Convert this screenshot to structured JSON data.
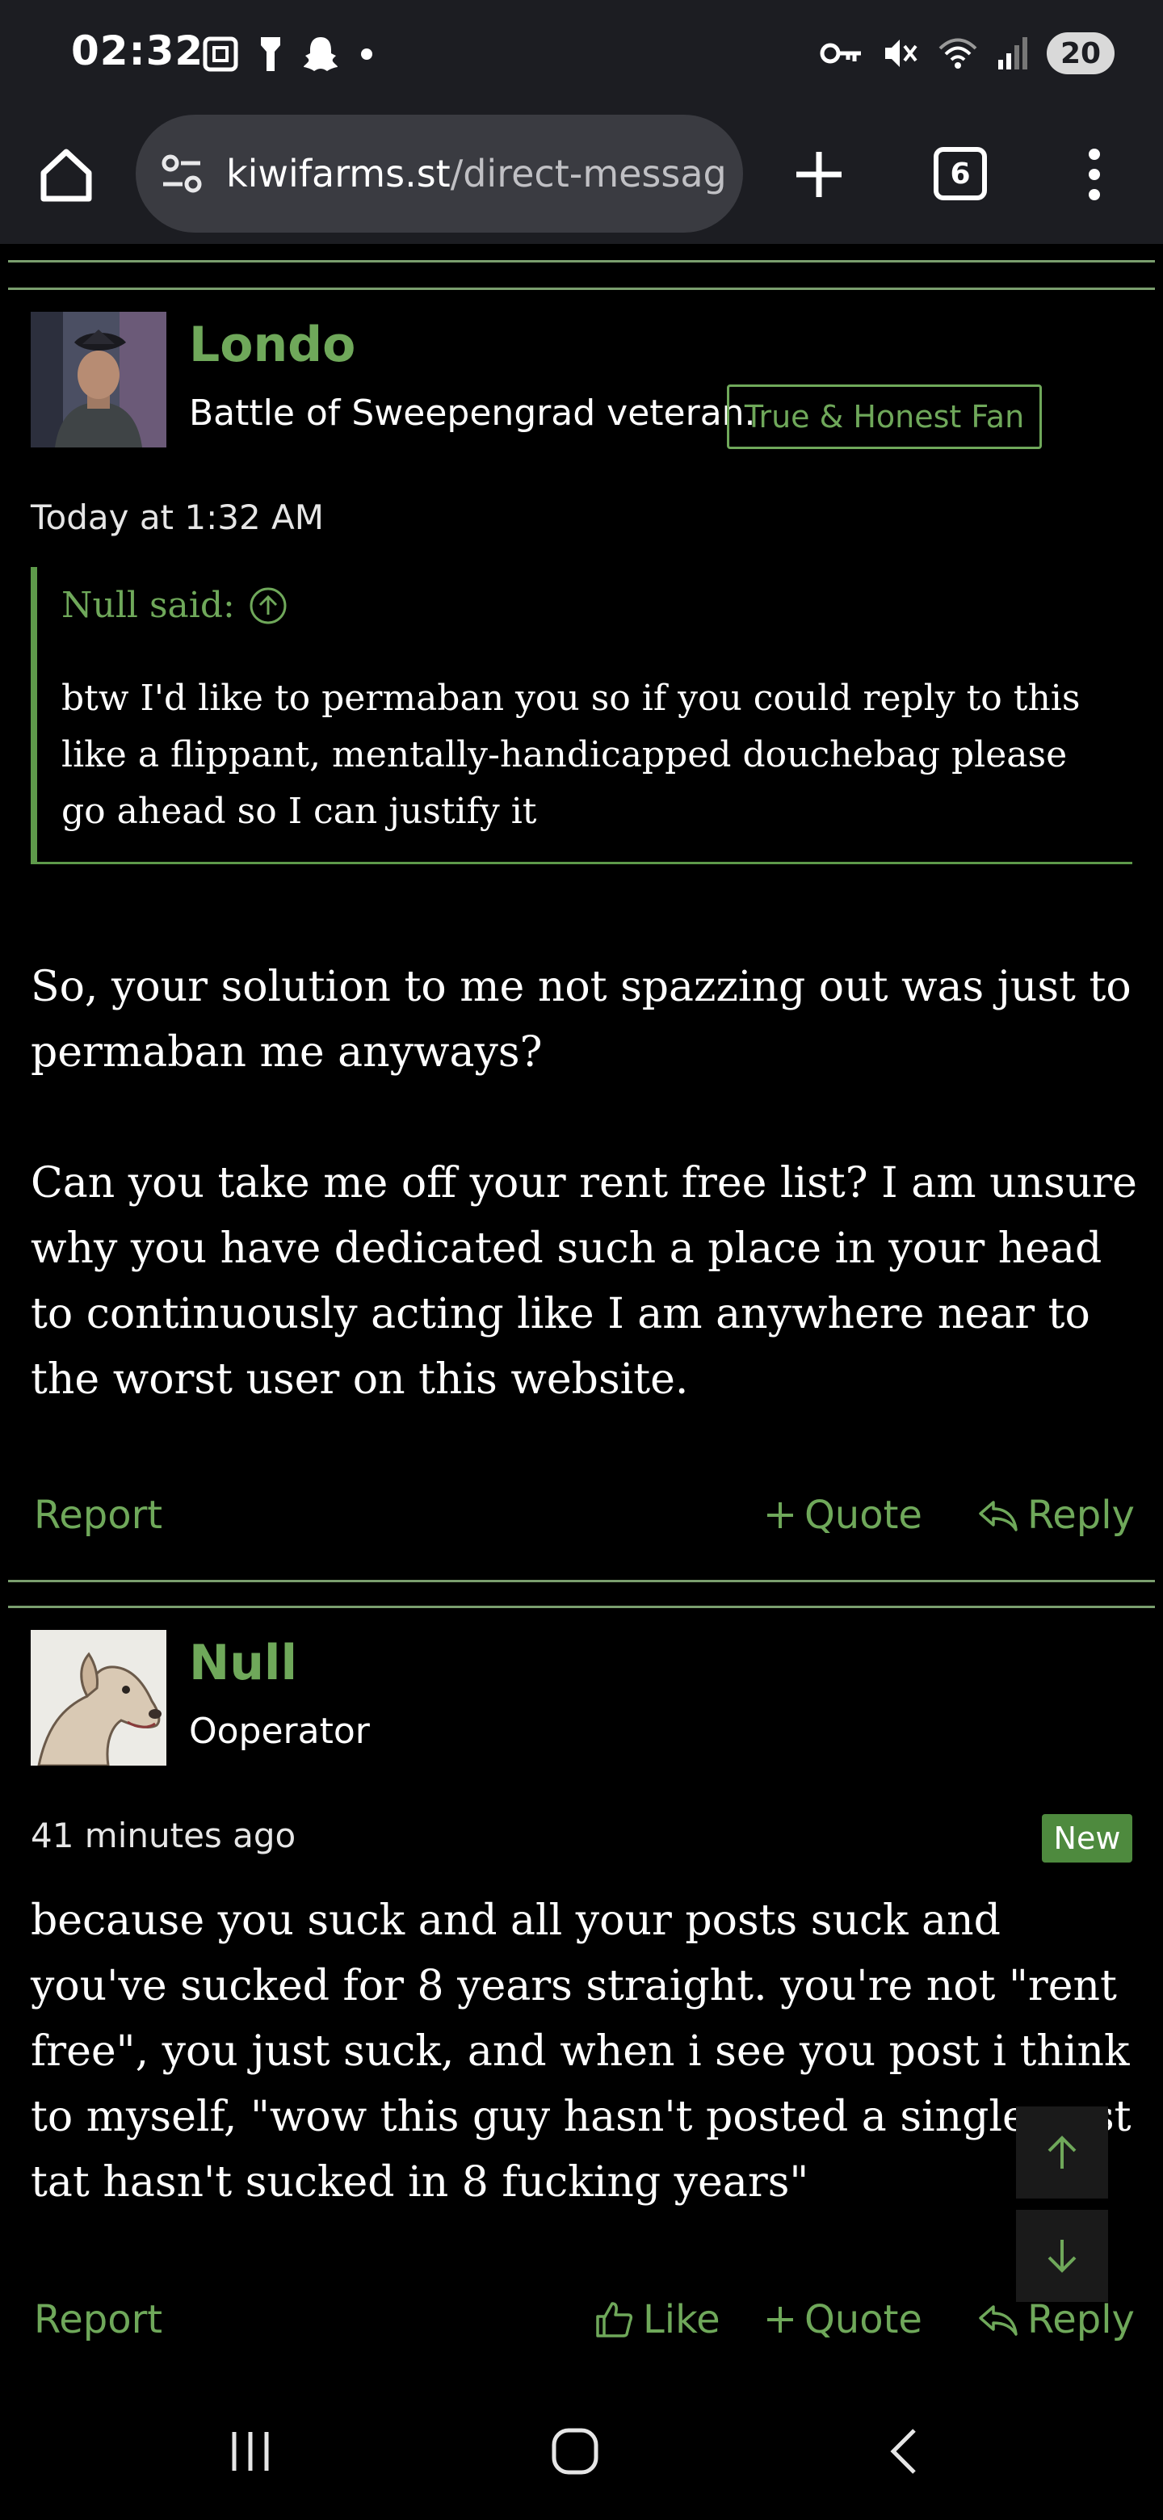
{
  "status_bar": {
    "time": "02:32",
    "battery": "20"
  },
  "browser": {
    "url_host": "kiwifarms.st",
    "url_path": "/direct-messag",
    "tab_count": "6"
  },
  "posts": [
    {
      "username": "Londo",
      "user_title": "Battle of Sweepengrad veteran.",
      "banner": "True & Honest Fan",
      "time": "Today at 1:32 AM",
      "quote": {
        "attribution": "Null said:",
        "text": "btw I'd like to permaban you so if you could reply to this like a flippant, mentally-handicapped douchebag please go ahead so I can justify it"
      },
      "paragraphs": [
        "So, your solution to me not spazzing out was just to permaban me anyways?",
        "Can you take me off your rent free list? I am unsure why you have dedicated such a place in your head to continuously acting like I am anywhere near to the worst user on this website."
      ],
      "actions": {
        "report": "Report",
        "quote": "Quote",
        "reply": "Reply"
      }
    },
    {
      "username": "Null",
      "user_title": "Ooperator",
      "time": "41 minutes ago",
      "badge": "New",
      "paragraphs": [
        "because you suck and all your posts suck and you've sucked for 8 years straight. you're not \"rent free\", you just suck, and when i see you post i think to myself, \"wow this guy hasn't posted a single post tat hasn't sucked in 8 fucking years\""
      ],
      "actions": {
        "report": "Report",
        "like": "Like",
        "quote": "Quote",
        "reply": "Reply"
      }
    }
  ],
  "colors": {
    "accent": "#6fa85a",
    "divider": "#7a9e6e",
    "chrome_bg": "#1c1d22",
    "url_bg": "#3a3b41",
    "badge_bg": "#4e8a3e"
  },
  "icons": {
    "status_left": [
      "screenshot-icon",
      "flashlight-icon",
      "snapchat-icon",
      "notification-dot-icon"
    ],
    "status_right": [
      "vpn-key-icon",
      "mute-icon",
      "wifi-icon",
      "signal-icon"
    ],
    "toolbar": [
      "home-icon",
      "site-settings-icon",
      "new-tab-icon",
      "tab-switcher-icon",
      "more-menu-icon"
    ],
    "nav": [
      "recent-apps-icon",
      "home-nav-icon",
      "back-icon"
    ]
  }
}
